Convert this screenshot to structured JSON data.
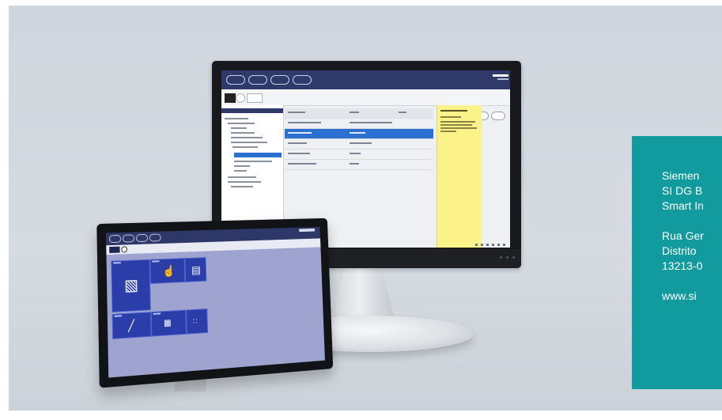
{
  "contact": {
    "line1": "Siemen",
    "line2": "SI DG  B",
    "line3": "Smart In",
    "line4": "Rua Ger",
    "line5": "Distrito",
    "line6": "13213-0",
    "line7": "www.si"
  },
  "colors": {
    "panel": "#119b9f",
    "background": "#d0d7de",
    "ui_header": "#2f3a6a",
    "ui_highlight": "#2b6fd0",
    "ui_info": "#fbf28a",
    "tablet_tile": "#2a3da8"
  },
  "icons": {
    "tablet_tiles": [
      "control-panel-icon",
      "hand-touch-icon",
      "document-icon",
      "wand-icon",
      "keypad-icon",
      "grid-icon"
    ]
  }
}
